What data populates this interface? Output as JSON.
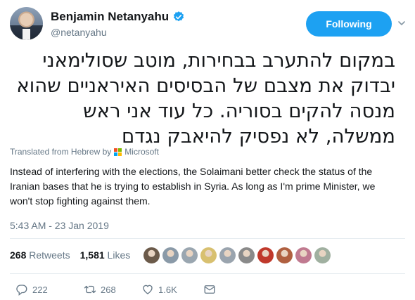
{
  "author": {
    "name": "Benjamin Netanyahu",
    "handle": "@netanyahu",
    "follow_label": "Following"
  },
  "tweet": {
    "text_hebrew": "במקום להתערב בבחירות, מוטב שסולימאני יבדוק את מצבם של הבסיסים האיראניים שהוא מנסה להקים בסוריה. כל עוד אני ראש ממשלה, לא נפסיק להיאבק נגדם",
    "translated_label": "Translated from Hebrew by",
    "translator": "Microsoft",
    "translation": "Instead of interfering with the elections, the Solaimani better check the status of the Iranian bases that he is trying to establish in Syria. As long as I'm prime Minister, we won't stop fighting against them.",
    "timestamp": "5:43 AM - 23 Jan 2019"
  },
  "stats": {
    "retweets_count": "268",
    "retweets_label": "Retweets",
    "likes_count": "1,581",
    "likes_label": "Likes"
  },
  "likers": [
    "#6b5a4a",
    "#8a9aa8",
    "#9aa6b0",
    "#d8c070",
    "#9aa4ae",
    "#8a8a8a",
    "#c0392b",
    "#b06040",
    "#c07a90",
    "#a0b0a0"
  ],
  "actions": {
    "replies": "222",
    "retweets": "268",
    "likes": "1.6K"
  },
  "colors": {
    "accent": "#1da1f2",
    "muted": "#657786"
  }
}
